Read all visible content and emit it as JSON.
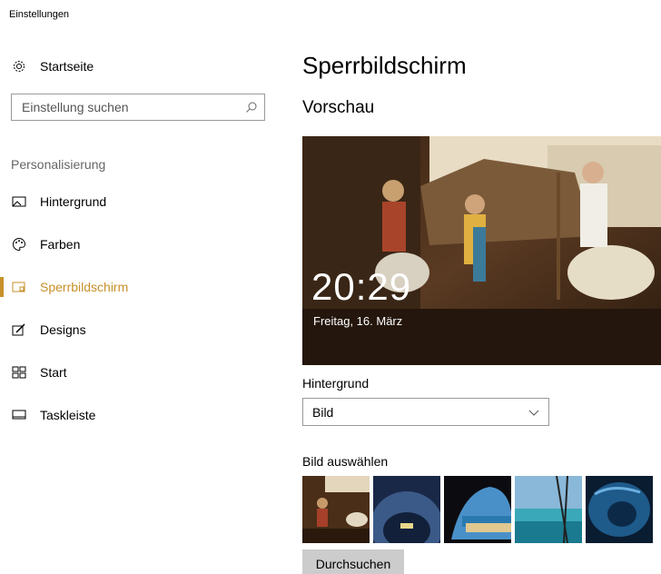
{
  "window": {
    "title": "Einstellungen"
  },
  "nav": {
    "home_label": "Startseite",
    "search_placeholder": "Einstellung suchen",
    "section_label": "Personalisierung",
    "items": [
      {
        "label": "Hintergrund",
        "icon": "image-icon"
      },
      {
        "label": "Farben",
        "icon": "palette-icon"
      },
      {
        "label": "Sperrbildschirm",
        "icon": "lock-screen-icon",
        "active": true
      },
      {
        "label": "Designs",
        "icon": "brush-icon"
      },
      {
        "label": "Start",
        "icon": "start-icon"
      },
      {
        "label": "Taskleiste",
        "icon": "taskbar-icon"
      }
    ]
  },
  "main": {
    "title": "Sperrbildschirm",
    "preview_heading": "Vorschau",
    "preview": {
      "time": "20:29",
      "date": "Freitag, 16. März"
    },
    "background_label": "Hintergrund",
    "background_value": "Bild",
    "choose_label": "Bild auswählen",
    "browse_button": "Durchsuchen"
  },
  "colors": {
    "accent": "#c8902a"
  }
}
